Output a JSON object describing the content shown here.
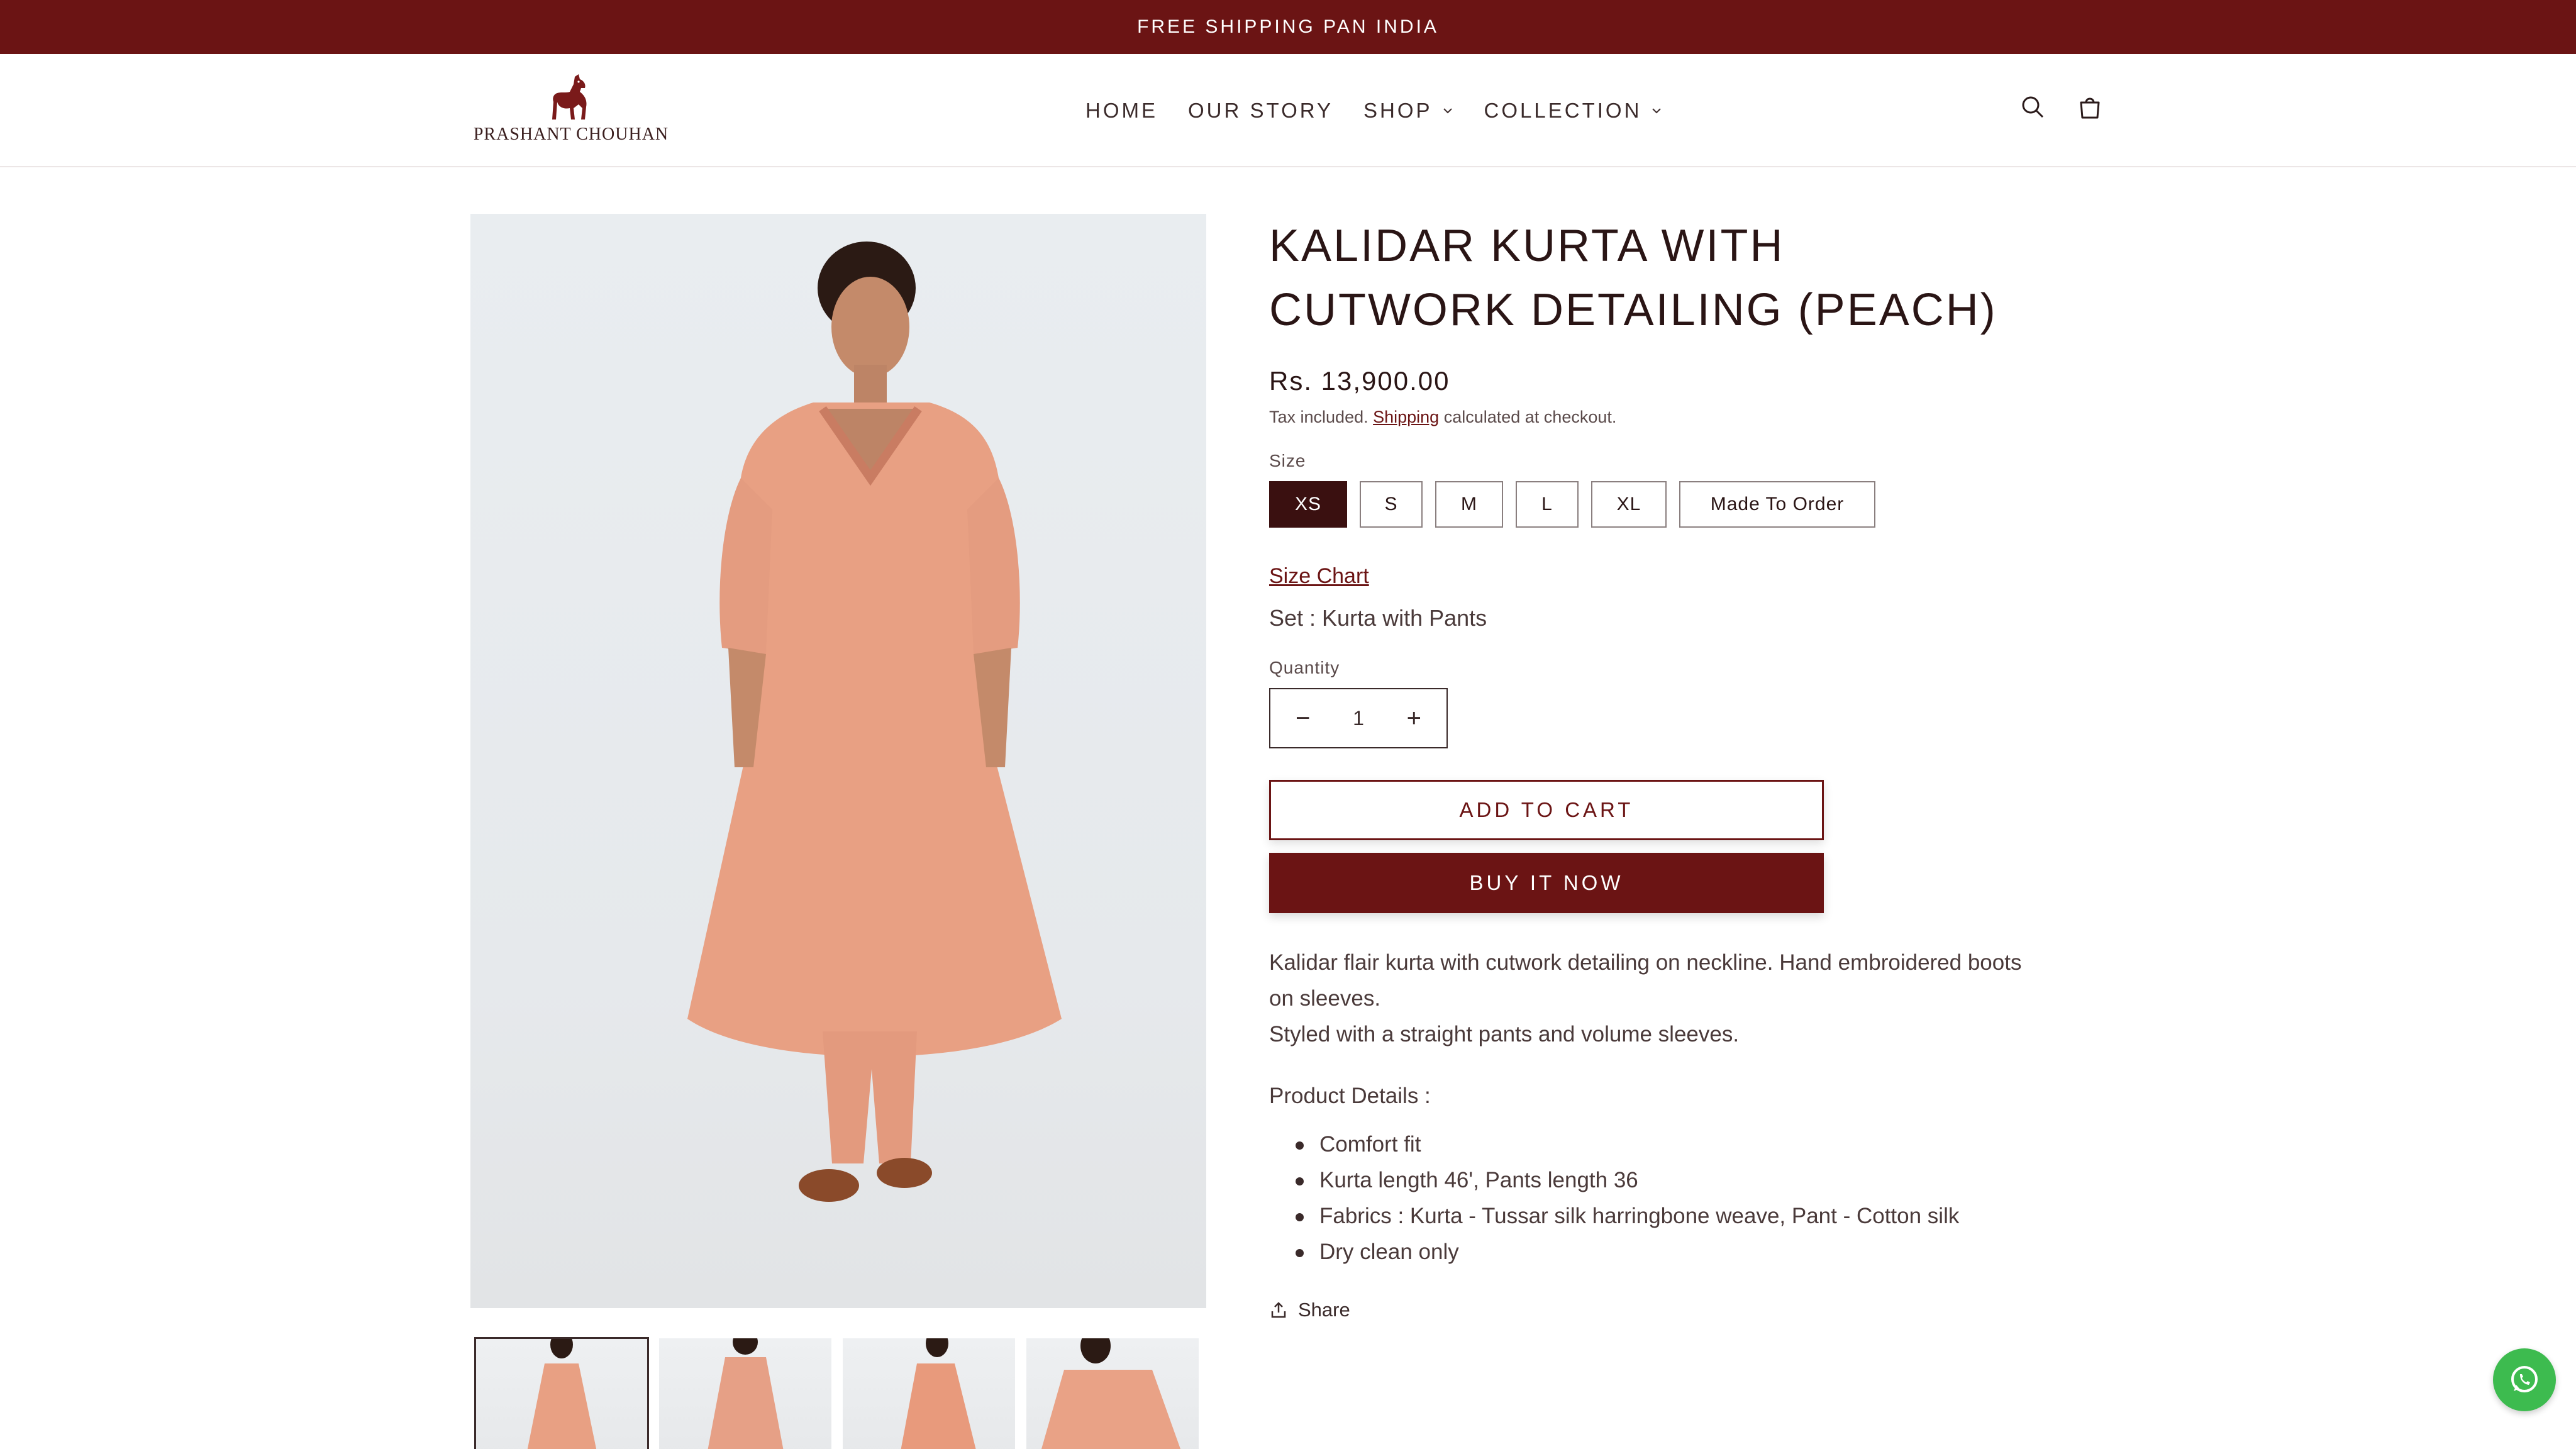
{
  "announcement": {
    "text": "FREE SHIPPING PAN INDIA"
  },
  "brand": {
    "name": "PRASHANT CHOUHAN",
    "logo_icon": "horse-icon"
  },
  "nav": {
    "items": [
      {
        "label": "HOME",
        "has_dropdown": false
      },
      {
        "label": "OUR STORY",
        "has_dropdown": false
      },
      {
        "label": "SHOP",
        "has_dropdown": true
      },
      {
        "label": "COLLECTION",
        "has_dropdown": true
      }
    ]
  },
  "header_icons": [
    "search-icon",
    "cart-icon"
  ],
  "product": {
    "title": "KALIDAR KURTA WITH CUTWORK DETAILING (PEACH)",
    "price": "Rs. 13,900.00",
    "tax_prefix": "Tax included. ",
    "tax_link": "Shipping",
    "tax_suffix": " calculated at checkout.",
    "size_label": "Size",
    "sizes": [
      "XS",
      "S",
      "M",
      "L",
      "XL",
      "Made To Order"
    ],
    "selected_size": "XS",
    "size_chart_label": "Size Chart",
    "set_line": "Set : Kurta with Pants",
    "quantity_label": "Quantity",
    "quantity": "1",
    "qty_minus": "−",
    "qty_plus": "+",
    "add_to_cart": "ADD TO CART",
    "buy_now": "BUY IT NOW",
    "description": [
      "Kalidar flair kurta with cutwork detailing on neckline. Hand embroidered boots on sleeves.",
      "Styled with a straight pants and volume sleeves."
    ],
    "details_heading": "Product Details :",
    "details": [
      "Comfort fit",
      "Kurta length 46', Pants length 36",
      "Fabrics : Kurta - Tussar silk harringbone weave, Pant - Cotton silk",
      "Dry clean only"
    ],
    "share_label": "Share"
  },
  "colors": {
    "brand": "#6b1414",
    "selected_size_bg": "#3a1010",
    "whatsapp": "#3dbb4f",
    "garment": "#e8a083"
  },
  "whatsapp_icon": "whatsapp-icon"
}
